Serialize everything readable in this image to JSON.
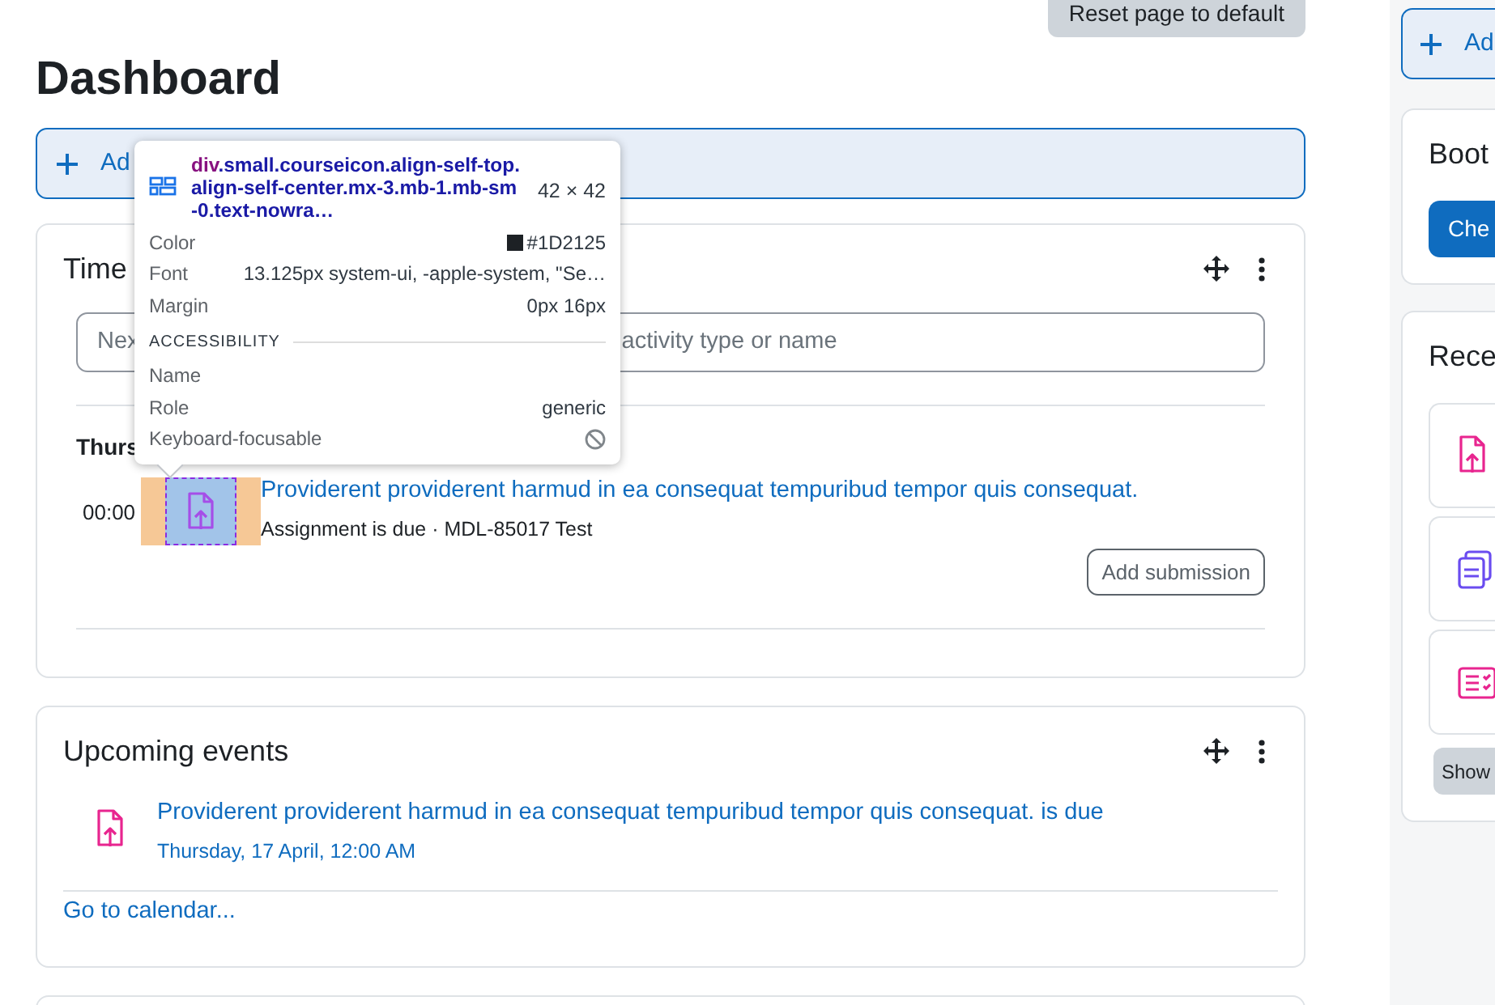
{
  "reset_button": "Reset page to default",
  "page_title": "Dashboard",
  "add_block": {
    "label": "Ad"
  },
  "timeline": {
    "title": "Time",
    "search": {
      "placeholder_parts": [
        "Nex",
        "activity type or name"
      ]
    },
    "day": "Thurs",
    "events": [
      {
        "time": "00:00",
        "title": "Providerent providerent harmud in ea consequat tempuribud tempor quis consequat.",
        "subtitle": "Assignment is due · MDL-85017 Test",
        "action": "Add submission",
        "highlighted": true,
        "color": "#a54ee8"
      }
    ]
  },
  "upcoming": {
    "title": "Upcoming events",
    "events": [
      {
        "title": "Providerent providerent harmud in ea consequat tempuribud tempor quis consequat. is due",
        "date": "Thursday, 17 April, 12:00 AM",
        "color": "#e8258f"
      }
    ],
    "footer_link": "Go to calendar..."
  },
  "sidebar": {
    "add_block": "Ad",
    "blocks": [
      {
        "kind": "button",
        "title": "Boot",
        "button": "Che"
      },
      {
        "kind": "items",
        "title": "Rece",
        "items": [
          {
            "kind": "upload",
            "color": "#e8258f"
          },
          {
            "kind": "stack",
            "color": "#6a4cf0"
          },
          {
            "kind": "checklist",
            "color": "#e8258f"
          }
        ],
        "more_button": "Show"
      }
    ]
  },
  "inspector": {
    "selector_tag": "div",
    "selector_classes": ".small.courseicon.align-self-top.align-self-center.mx-3.mb-1.mb-sm-0.text-nowra…",
    "size": "42 × 42",
    "rows": [
      {
        "label": "Color",
        "value": "#1D2125",
        "color": "#1d2125"
      },
      {
        "label": "Font",
        "value": "13.125px system-ui, -apple-system, \"Se…"
      },
      {
        "label": "Margin",
        "value": "0px 16px"
      }
    ],
    "section": "ACCESSIBILITY",
    "a11y": [
      {
        "kind": "text",
        "label": "Name"
      },
      {
        "kind": "text",
        "label": "Role",
        "value": "generic"
      },
      {
        "kind": "flag",
        "label": "Keyboard-focusable",
        "on": false
      }
    ]
  }
}
